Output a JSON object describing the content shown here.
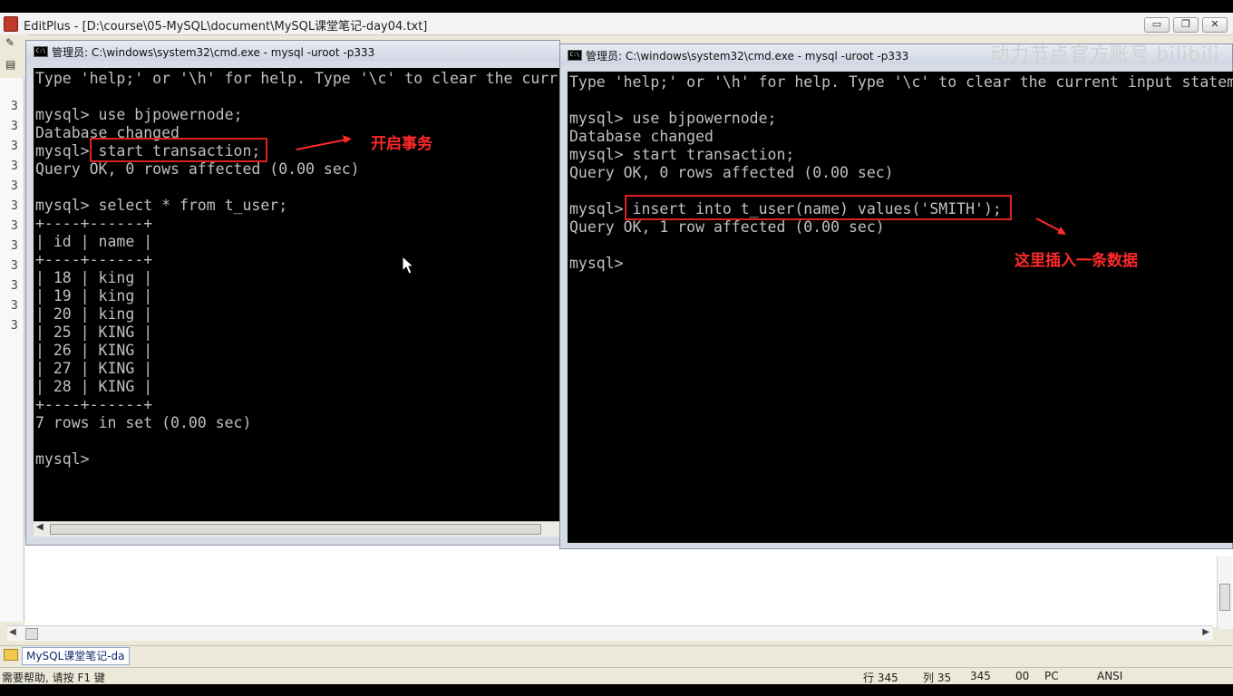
{
  "editplus": {
    "title": "EditPlus - [D:\\course\\05-MySQL\\document\\MySQL课堂笔记-day04.txt]",
    "window_buttons": {
      "minimize": "▭",
      "maximize": "❐",
      "close": "✕"
    },
    "line_numbers": [
      "3",
      "3",
      "3",
      "3",
      "3",
      "3",
      "3",
      "3",
      "3",
      "3",
      "3",
      "3"
    ],
    "tab_label": "MySQL课堂笔记-da",
    "status": {
      "help": "需要帮助, 请按 F1 键",
      "row": "行 345",
      "col": "列 35",
      "total": "345",
      "sel": "00",
      "mode": "PC",
      "encoding": "ANSI"
    }
  },
  "cmd_left": {
    "title": "管理员: C:\\windows\\system32\\cmd.exe - mysql  -uroot -p333",
    "lines": [
      "Type 'help;' or '\\h' for help. Type '\\c' to clear the curr",
      "",
      "mysql> use bjpowernode;",
      "Database changed",
      "mysql> start transaction;",
      "Query OK, 0 rows affected (0.00 sec)",
      "",
      "mysql> select * from t_user;",
      "+----+------+",
      "| id | name |",
      "+----+------+",
      "| 18 | king |",
      "| 19 | king |",
      "| 20 | king |",
      "| 25 | KING |",
      "| 26 | KING |",
      "| 27 | KING |",
      "| 28 | KING |",
      "+----+------+",
      "7 rows in set (0.00 sec)",
      "",
      "mysql>"
    ],
    "annotation": "开启事务"
  },
  "cmd_right": {
    "title": "管理员: C:\\windows\\system32\\cmd.exe - mysql  -uroot -p333",
    "lines": [
      "Type 'help;' or '\\h' for help. Type '\\c' to clear the current input statem",
      "",
      "mysql> use bjpowernode;",
      "Database changed",
      "mysql> start transaction;",
      "Query OK, 0 rows affected (0.00 sec)",
      "",
      "mysql> insert into t_user(name) values('SMITH');",
      "Query OK, 1 row affected (0.00 sec)",
      "",
      "mysql>"
    ],
    "annotation": "这里插入一条数据"
  },
  "watermark": "动力节点官方账号 bilibili",
  "colors": {
    "annotation": "#ff2a2a",
    "console_bg": "#000000",
    "console_text": "#c0c0c0"
  }
}
